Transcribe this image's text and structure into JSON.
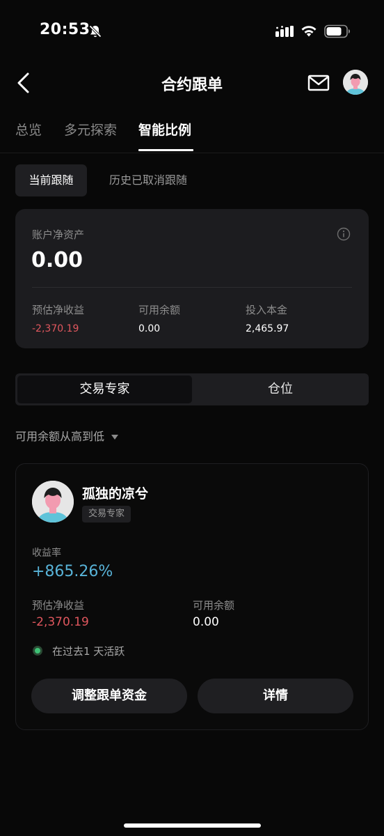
{
  "status_bar": {
    "time": "20:53"
  },
  "nav": {
    "title": "合约跟单"
  },
  "tabs": [
    {
      "label": "总览"
    },
    {
      "label": "多元探索"
    },
    {
      "label": "智能比例"
    }
  ],
  "sub_tabs": [
    {
      "label": "当前跟随"
    },
    {
      "label": "历史已取消跟随"
    }
  ],
  "account": {
    "label": "账户净资产",
    "value": "0.00",
    "stats": [
      {
        "label": "预估净收益",
        "value": "-2,370.19"
      },
      {
        "label": "可用余额",
        "value": "0.00"
      },
      {
        "label": "投入本金",
        "value": "2,465.97"
      }
    ]
  },
  "segment": [
    {
      "label": "交易专家"
    },
    {
      "label": "仓位"
    }
  ],
  "sort": {
    "label": "可用余额从高到低"
  },
  "trader": {
    "name": "孤独的凉兮",
    "badge": "交易专家",
    "roi_label": "收益率",
    "roi_value": "+865.26%",
    "pnl_label": "预估净收益",
    "pnl_value": "-2,370.19",
    "balance_label": "可用余额",
    "balance_value": "0.00",
    "activity": "在过去1 天活跃",
    "adjust_button": "调整跟单资金",
    "detail_button": "详情"
  },
  "colors": {
    "negative": "#e0575e",
    "roi": "#58b3d8",
    "active": "#3ec275"
  },
  "icons": [
    "back-arrow-icon",
    "mail-icon",
    "info-icon",
    "bell-off-icon",
    "signal-icon",
    "wifi-icon",
    "battery-icon",
    "sort-caret-icon"
  ]
}
